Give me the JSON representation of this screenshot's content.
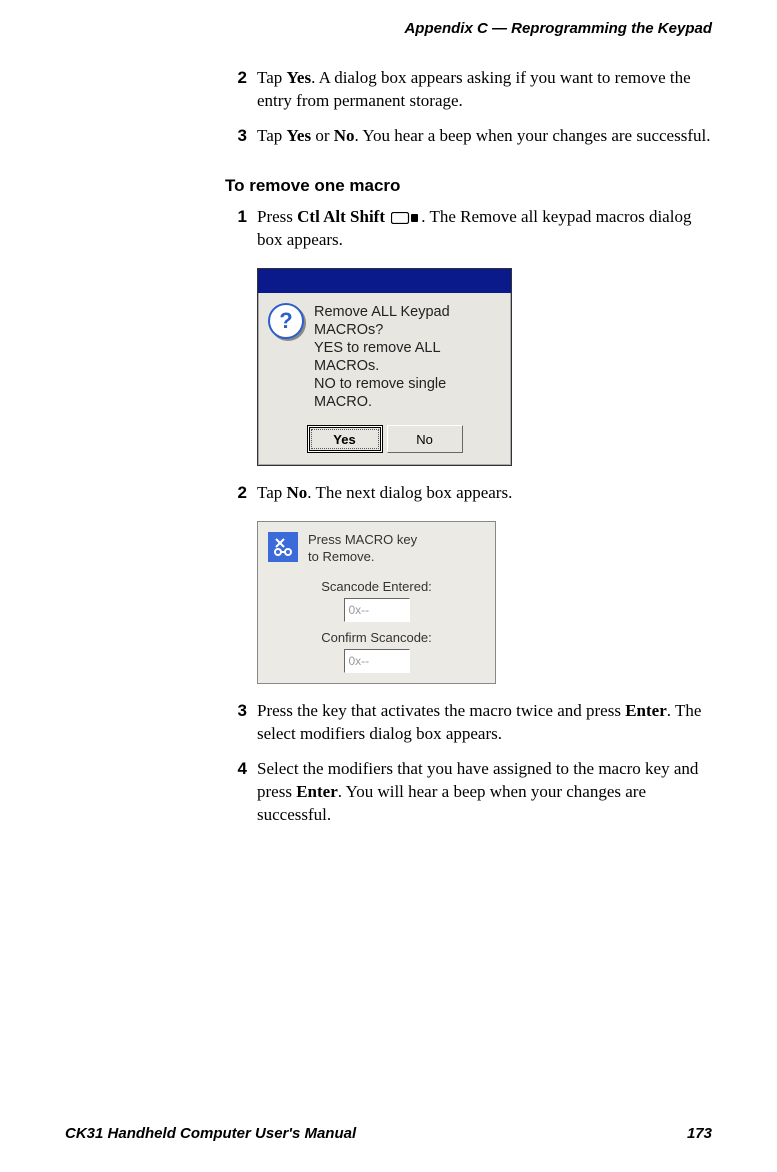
{
  "header": "Appendix C — Reprogramming the Keypad",
  "steps_a": [
    {
      "num": "2",
      "pre": "Tap ",
      "b1": "Yes",
      "post": ". A dialog box appears asking if you want to remove the entry from permanent storage."
    },
    {
      "num": "3",
      "pre": "Tap ",
      "b1": "Yes",
      "mid": " or ",
      "b2": "No",
      "post": ". You hear a beep when your changes are successful."
    }
  ],
  "subhead1": "To remove one macro",
  "step1": {
    "num": "1",
    "pre": "Press ",
    "b1": "Ctl Alt Shift",
    "post": ". The Remove all keypad macros dialog box appears."
  },
  "dialog1": {
    "icon": "?",
    "line1": "Remove ALL Keypad",
    "line2": "MACROs?",
    "line3": "YES to remove ALL",
    "line4": "MACROs.",
    "line5": "NO to remove single",
    "line6": "MACRO.",
    "yes": "Yes",
    "no": "No"
  },
  "step2": {
    "num": "2",
    "pre": "Tap ",
    "b1": "No",
    "post": ". The next dialog box appears."
  },
  "dialog2": {
    "line1": "Press MACRO key",
    "line2": "to Remove.",
    "label1": "Scancode Entered:",
    "input1": "0x--",
    "label2": "Confirm Scancode:",
    "input2": "0x--"
  },
  "step3": {
    "num": "3",
    "pre": "Press the key that activates the macro twice and press ",
    "b1": "Enter",
    "post": ". The select modifiers dialog box appears."
  },
  "step4": {
    "num": "4",
    "pre": "Select the modifiers that you have assigned to the macro key and press ",
    "b1": "Enter",
    "post": ". You will hear a beep when your changes are successful."
  },
  "footer_left": "CK31 Handheld Computer User's Manual",
  "footer_right": "173"
}
